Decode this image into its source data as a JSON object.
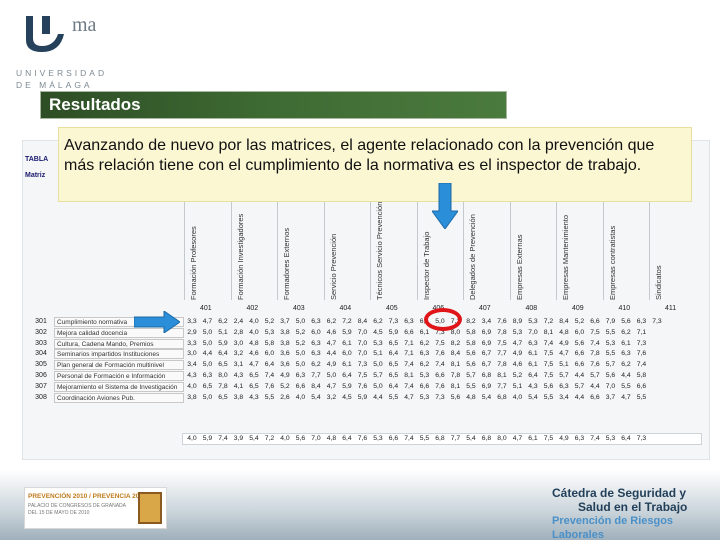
{
  "logo": {
    "uma": "ma",
    "line1": "UNIVERSIDAD",
    "line2": "DE MÁLAGA"
  },
  "section": {
    "title": "Resultados"
  },
  "note": {
    "text": "Avanzando de nuevo por las matrices, el agente relacionado con la prevención que más relación tiene con el cumplimiento de la normativa es el inspector de trabajo."
  },
  "table": {
    "label_tabla": "TABLA",
    "label_matriz": "Matriz",
    "columns": [
      {
        "code": "401",
        "label": "Formación Profesores"
      },
      {
        "code": "402",
        "label": "Formación Investigadores"
      },
      {
        "code": "403",
        "label": "Formadores Externos"
      },
      {
        "code": "404",
        "label": "Servicio Prevención"
      },
      {
        "code": "405",
        "label": "Técnicos Servicio Prevención"
      },
      {
        "code": "406",
        "label": "Inspector de Trabajo"
      },
      {
        "code": "407",
        "label": "Delegados de Prevención"
      },
      {
        "code": "408",
        "label": "Empresas Externas"
      },
      {
        "code": "409",
        "label": "Empresas Mantenimiento"
      },
      {
        "code": "410",
        "label": "Empresas contratistas"
      },
      {
        "code": "411",
        "label": "Sindicatos"
      }
    ],
    "rows": [
      {
        "code": "301",
        "label": "Cumplimiento normativa",
        "values": [
          "3,3",
          "4,7",
          "6,2",
          "2,4",
          "4,0",
          "5,2",
          "3,7",
          "5,0",
          "6,3",
          "6,2",
          "7,2",
          "8,4",
          "6,2",
          "7,3",
          "6,3",
          "6,1",
          "5,0",
          "7,2",
          "8,2",
          "3,4",
          "7,6",
          "8,9",
          "5,3",
          "7,2",
          "8,4",
          "5,2",
          "6,6",
          "7,9",
          "5,6",
          "6,3",
          "7,3"
        ]
      },
      {
        "code": "302",
        "label": "Mejora calidad docencia",
        "values": [
          "2,9",
          "5,0",
          "5,1",
          "2,8",
          "4,0",
          "5,3",
          "3,8",
          "5,2",
          "6,0",
          "4,6",
          "5,9",
          "7,0",
          "4,5",
          "5,9",
          "6,6",
          "6,1",
          "7,3",
          "8,0",
          "5,8",
          "6,9",
          "7,8",
          "5,3",
          "7,0",
          "8,1",
          "4,8",
          "6,0",
          "7,5",
          "5,5",
          "6,2",
          "7,1"
        ]
      },
      {
        "code": "303",
        "label": "Cultura, Cadena Mando, Premios",
        "values": [
          "3,3",
          "5,0",
          "5,9",
          "3,0",
          "4,8",
          "5,8",
          "3,8",
          "5,2",
          "6,3",
          "4,7",
          "6,1",
          "7,0",
          "5,3",
          "6,5",
          "7,1",
          "6,2",
          "7,5",
          "8,2",
          "5,8",
          "6,9",
          "7,5",
          "4,7",
          "6,3",
          "7,4",
          "4,9",
          "5,6",
          "7,4",
          "5,3",
          "6,1",
          "7,3"
        ]
      },
      {
        "code": "304",
        "label": "Seminarios impartidos Instituciones",
        "values": [
          "3,0",
          "4,4",
          "6,4",
          "3,2",
          "4,6",
          "6,0",
          "3,6",
          "5,0",
          "6,3",
          "4,4",
          "6,0",
          "7,0",
          "5,1",
          "6,4",
          "7,1",
          "6,3",
          "7,6",
          "8,4",
          "5,6",
          "6,7",
          "7,7",
          "4,9",
          "6,1",
          "7,5",
          "4,7",
          "6,6",
          "7,8",
          "5,5",
          "6,3",
          "7,6"
        ]
      },
      {
        "code": "305",
        "label": "Plan general de Formación multinivel",
        "values": [
          "3,4",
          "5,0",
          "6,5",
          "3,1",
          "4,7",
          "6,4",
          "3,6",
          "5,0",
          "6,2",
          "4,9",
          "6,1",
          "7,3",
          "5,0",
          "6,5",
          "7,4",
          "6,2",
          "7,4",
          "8,1",
          "5,6",
          "6,7",
          "7,8",
          "4,6",
          "6,1",
          "7,5",
          "5,1",
          "6,6",
          "7,6",
          "5,7",
          "6,2",
          "7,4"
        ]
      },
      {
        "code": "306",
        "label": "Personal de Formación e Información",
        "values": [
          "4,3",
          "6,3",
          "8,0",
          "4,3",
          "6,5",
          "7,4",
          "4,9",
          "6,3",
          "7,7",
          "5,0",
          "6,4",
          "7,5",
          "5,7",
          "6,5",
          "8,1",
          "5,3",
          "6,6",
          "7,8",
          "5,7",
          "6,8",
          "8,1",
          "5,2",
          "6,4",
          "7,5",
          "5,7",
          "4,4",
          "5,7",
          "5,6",
          "4,4",
          "5,8"
        ]
      },
      {
        "code": "307",
        "label": "Mejoramiento el Sistema de Investigación",
        "values": [
          "4,0",
          "6,5",
          "7,8",
          "4,1",
          "6,5",
          "7,6",
          "5,2",
          "6,6",
          "8,4",
          "4,7",
          "5,9",
          "7,6",
          "5,0",
          "6,4",
          "7,4",
          "6,6",
          "7,6",
          "8,1",
          "5,5",
          "6,9",
          "7,7",
          "5,1",
          "4,3",
          "5,6",
          "6,3",
          "5,7",
          "4,4",
          "7,0",
          "5,5",
          "6,6"
        ]
      },
      {
        "code": "308",
        "label": "Coordinación Aviones Pub.",
        "values": [
          "3,8",
          "5,0",
          "6,5",
          "3,8",
          "4,3",
          "5,5",
          "2,6",
          "4,0",
          "5,4",
          "3,2",
          "4,5",
          "5,9",
          "4,4",
          "5,5",
          "4,7",
          "5,3",
          "7,3",
          "5,6",
          "4,8",
          "5,4",
          "6,8",
          "4,0",
          "5,4",
          "5,5",
          "3,4",
          "4,4",
          "6,6",
          "3,7",
          "4,7",
          "5,5"
        ]
      }
    ],
    "averages": [
      "4,0",
      "5,9",
      "7,4",
      "3,9",
      "5,4",
      "7,2",
      "4,0",
      "5,6",
      "7,0",
      "4,8",
      "6,4",
      "7,6",
      "5,3",
      "6,6",
      "7,4",
      "5,5",
      "6,8",
      "7,7",
      "5,4",
      "6,8",
      "8,0",
      "4,7",
      "6,1",
      "7,5",
      "4,9",
      "6,3",
      "7,4",
      "5,3",
      "6,4",
      "7,3"
    ]
  },
  "event_logo": {
    "line1": "PREVENCIÓN 2010 / PREVENCIA 2010",
    "line2": "PALACIO DE CONGRESOS DE GRANADA",
    "line3": "DEL 15 DE MAYO DE 2010"
  },
  "brand": {
    "line1": "Cátedra de Seguridad y",
    "line2": "Salud en el Trabajo",
    "line3": "Prevención de Riesgos Laborales"
  },
  "colors": {
    "section_bar": "#3e6b33",
    "highlight": "#e0151a",
    "arrow": "#2a8fd8",
    "note_bg": "#fbf7d3"
  }
}
